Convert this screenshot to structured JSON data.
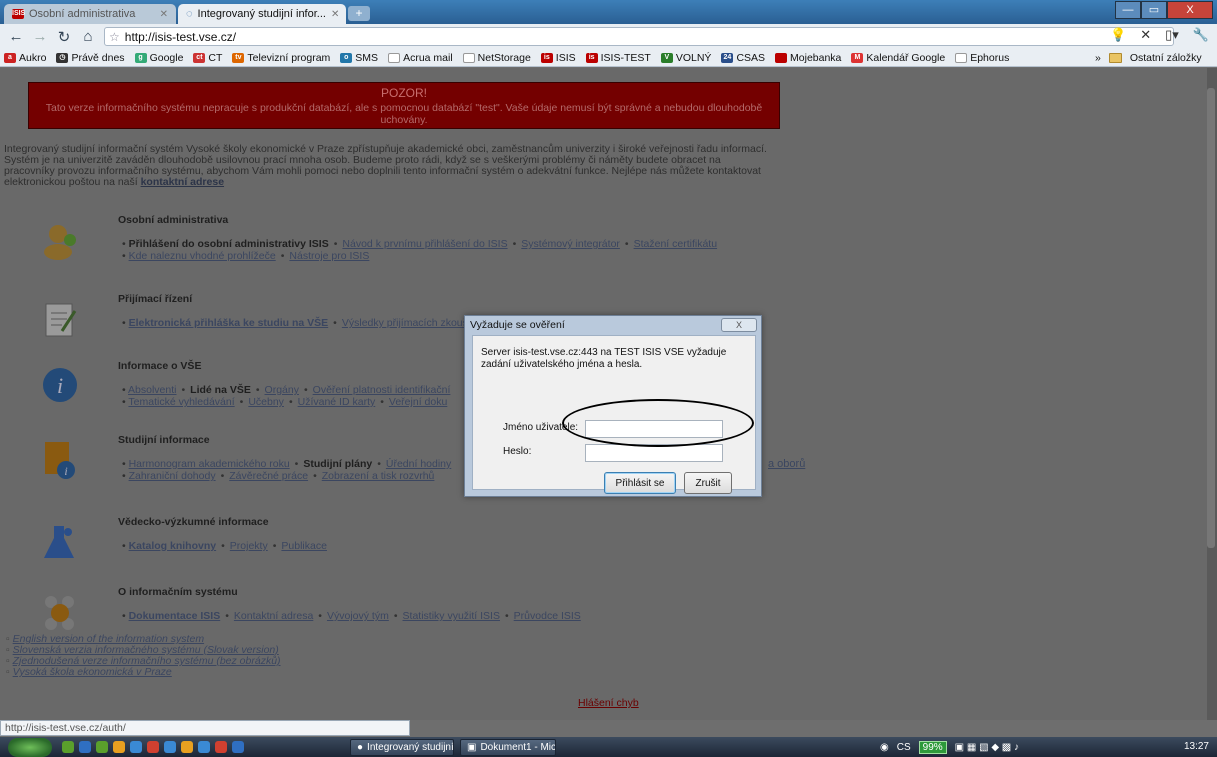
{
  "tabs": [
    {
      "label": "Osobní administrativa"
    },
    {
      "label": "Integrovaný studijní infor..."
    }
  ],
  "window": {
    "minimize": "—",
    "maximize": "▭",
    "close": "X"
  },
  "toolbar": {
    "url": "http://isis-test.vse.cz/"
  },
  "bookmarks": [
    {
      "label": "Aukro",
      "color": "#c22"
    },
    {
      "label": "Právě dnes",
      "color": "#333"
    },
    {
      "label": "Google",
      "color": "#3a7"
    },
    {
      "label": "CT",
      "color": "#c33"
    },
    {
      "label": "Televizní program",
      "color": "#d60"
    },
    {
      "label": "SMS",
      "color": "#27a"
    },
    {
      "label": "Acrua mail",
      "color": "#888"
    },
    {
      "label": "NetStorage",
      "color": "#888"
    },
    {
      "label": "ISIS",
      "color": "#b00"
    },
    {
      "label": "ISIS-TEST",
      "color": "#b00"
    },
    {
      "label": "VOLNÝ",
      "color": "#2a7d2a"
    },
    {
      "label": "CSAS",
      "color": "#2a4e8a"
    },
    {
      "label": "Mojebanka",
      "color": "#b00"
    },
    {
      "label": "Kalendář Google",
      "color": "#d33"
    },
    {
      "label": "Ephorus",
      "color": "#888"
    }
  ],
  "bookmarks_other": "Ostatní záložky",
  "page": {
    "banner_title": "POZOR!",
    "banner_text": "Tato verze informačního systému nepracuje s produkční databází, ale s pomocnou databází \"test\". Vaše údaje nemusí být správné a nebudou dlouhodobě uchovány.",
    "intro_text": "Integrovaný studijní informační systém Vysoké školy ekonomické v Praze zpřístupňuje akademické obci, zaměstnancům univerzity i široké veřejnosti řadu informací. Systém je na univerzitě zaváděn dlouhodobě usilovnou prací mnoha osob. Budeme proto rádi, když se s veškerými problémy či náměty budete obracet na pracovníky provozu informačního systému, abychom Vám mohli pomoci nebo doplnili tento informační systém o adekvátní funkce. Nejlépe nás můžete kontaktovat elektronickou poštou na naší",
    "intro_link": "kontaktní adrese",
    "sections": [
      {
        "heading": "Osobní administrativa",
        "rows": [
          [
            "Přihlášení do osobní administrativy ISIS",
            "Návod k prvnímu přihlášení do ISIS",
            "Systémový integrátor",
            "Stažení certifikátu"
          ],
          [
            "Kde naleznu vhodné prohlížeče",
            "Nástroje pro ISIS"
          ]
        ]
      },
      {
        "heading": "Přijímací řízení",
        "rows": [
          [
            "Elektronická přihláška ke studiu na VŠE",
            "Výsledky přijímacích zkoušek"
          ]
        ]
      },
      {
        "heading": "Informace o VŠE",
        "rows": [
          [
            "Absolventi",
            "Lidé na VŠE",
            "Orgány",
            "Ověření platnosti identifikační"
          ],
          [
            "Tematické vyhledávání",
            "Učebny",
            "Užívané ID karty",
            "Veřejní doku"
          ]
        ]
      },
      {
        "heading": "Studijní informace",
        "rows": [
          [
            "Harmonogram akademického roku",
            "Studijní plány",
            "Úřední hodiny"
          ],
          [
            "Zahraniční dohody",
            "Závěrečné práce",
            "Zobrazení a tisk rozvrhů"
          ]
        ],
        "extra": "a oborů"
      },
      {
        "heading": "Vědecko-výzkumné informace",
        "rows": [
          [
            "Katalog knihovny",
            "Projekty",
            "Publikace"
          ]
        ]
      },
      {
        "heading": "O informačním systému",
        "rows": [
          [
            "Dokumentace ISIS",
            "Kontaktní adresa",
            "Vývojový tým",
            "Statistiky využití ISIS",
            "Průvodce ISIS"
          ]
        ]
      }
    ],
    "footer_links": [
      "English version of the information system",
      "Slovenská verzia informačného systému (Slovak version)",
      "Zjednodušená verze informačního systému (bez obrázků)",
      "Vysoká škola ekonomická v Praze"
    ],
    "error_link": "Hlášení chyb",
    "status_url": "http://isis-test.vse.cz/auth/"
  },
  "dialog": {
    "title": "Vyžaduje se ověření",
    "close": "X",
    "message": "Server isis-test.vse.cz:443 na TEST ISIS VSE vyžaduje zadání uživatelského jména a hesla.",
    "username_label": "Jméno uživatele:",
    "username_value": "",
    "password_label": "Heslo:",
    "password_value": "",
    "login_button": "Přihlásit se",
    "cancel_button": "Zrušit"
  },
  "taskbar": {
    "items": [
      "Integrovaný studijní...",
      "Dokument1 - Micro..."
    ],
    "lang": "CS",
    "battery": "99%",
    "clock": "13:27"
  }
}
